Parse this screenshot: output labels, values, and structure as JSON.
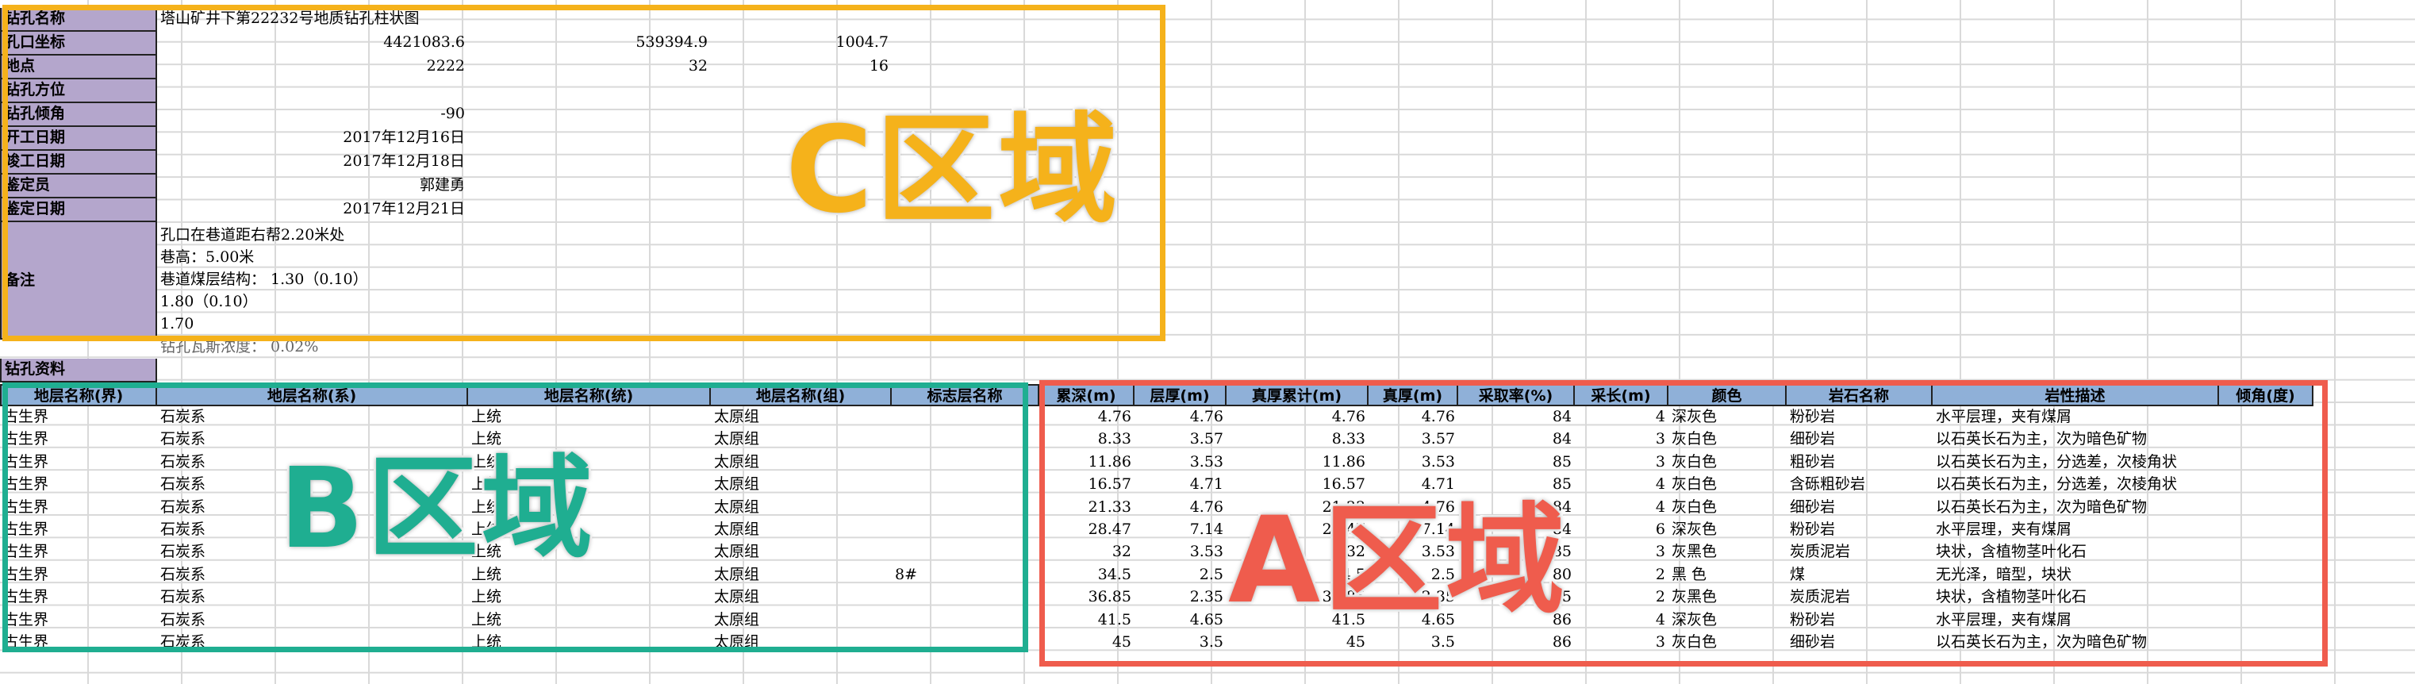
{
  "info": {
    "labels": [
      "钻孔名称",
      "孔口坐标",
      "地点",
      "钻孔方位",
      "钻孔倾角",
      "开工日期",
      "竣工日期",
      "鉴定员",
      "鉴定日期"
    ],
    "remark_label": "备注",
    "data_label": "钻孔资料",
    "name": "塔山矿井下第22232号地质钻孔柱状图",
    "coord_x": "4421083.6",
    "coord_y": "539394.9",
    "coord_z": "1004.7",
    "place_a": "2222",
    "place_b": "32",
    "place_c": "16",
    "azimuth": "",
    "dip": "-90",
    "start_date": "2017年12月16日",
    "end_date": "2017年12月18日",
    "inspector": "郭建勇",
    "inspect_date": "2017年12月21日",
    "remarks": [
      "孔口在巷道距右帮2.20米处",
      "巷高：5.00米",
      "巷道煤层结构： 1.30（0.10）",
      "1.80（0.10）",
      "1.70"
    ],
    "gas_text": "钻孔瓦斯浓度： 0.02%"
  },
  "table": {
    "headers": [
      "地层名称(界)",
      "地层名称(系)",
      "地层名称(统)",
      "地层名称(组)",
      "标志层名称",
      "累深(m)",
      "层厚(m)",
      "真厚累计(m)",
      "真厚(m)",
      "采取率(%)",
      "采长(m)",
      "颜色",
      "岩石名称",
      "岩性描述",
      "倾角(度)"
    ],
    "rows": [
      [
        "古生界",
        "石炭系",
        "上统",
        "太原组",
        "",
        "4.76",
        "4.76",
        "4.76",
        "4.76",
        "84",
        "4",
        "深灰色",
        "粉砂岩",
        "水平层理，夹有煤屑",
        ""
      ],
      [
        "古生界",
        "石炭系",
        "上统",
        "太原组",
        "",
        "8.33",
        "3.57",
        "8.33",
        "3.57",
        "84",
        "3",
        "灰白色",
        "细砂岩",
        "以石英长石为主，次为暗色矿物",
        ""
      ],
      [
        "古生界",
        "石炭系",
        "上统",
        "太原组",
        "",
        "11.86",
        "3.53",
        "11.86",
        "3.53",
        "85",
        "3",
        "灰白色",
        "粗砂岩",
        "以石英长石为主，分选差，次棱角状",
        ""
      ],
      [
        "古生界",
        "石炭系",
        "上统",
        "太原组",
        "",
        "16.57",
        "4.71",
        "16.57",
        "4.71",
        "85",
        "4",
        "灰白色",
        "含砾粗砂岩",
        "以石英长石为主，分选差，次棱角状",
        ""
      ],
      [
        "古生界",
        "石炭系",
        "上统",
        "太原组",
        "",
        "21.33",
        "4.76",
        "21.33",
        "4.76",
        "84",
        "4",
        "灰白色",
        "细砂岩",
        "以石英长石为主，次为暗色矿物",
        ""
      ],
      [
        "古生界",
        "石炭系",
        "上统",
        "太原组",
        "",
        "28.47",
        "7.14",
        "28.47",
        "7.14",
        "84",
        "6",
        "深灰色",
        "粉砂岩",
        "水平层理，夹有煤屑",
        ""
      ],
      [
        "古生界",
        "石炭系",
        "上统",
        "太原组",
        "",
        "32",
        "3.53",
        "32",
        "3.53",
        "85",
        "3",
        "灰黑色",
        "炭质泥岩",
        "块状，含植物茎叶化石",
        ""
      ],
      [
        "古生界",
        "石炭系",
        "上统",
        "太原组",
        "8#",
        "34.5",
        "2.5",
        "34.5",
        "2.5",
        "80",
        "2",
        "黑 色",
        "煤",
        "无光泽，暗型，块状",
        ""
      ],
      [
        "古生界",
        "石炭系",
        "上统",
        "太原组",
        "",
        "36.85",
        "2.35",
        "36.85",
        "2.35",
        "85",
        "2",
        "灰黑色",
        "炭质泥岩",
        "块状，含植物茎叶化石",
        ""
      ],
      [
        "古生界",
        "石炭系",
        "上统",
        "太原组",
        "",
        "41.5",
        "4.65",
        "41.5",
        "4.65",
        "86",
        "4",
        "深灰色",
        "粉砂岩",
        "水平层理，夹有煤屑",
        ""
      ],
      [
        "古生界",
        "石炭系",
        "上统",
        "太原组",
        "",
        "45",
        "3.5",
        "45",
        "3.5",
        "86",
        "3",
        "灰白色",
        "细砂岩",
        "以石英长石为主，次为暗色矿物",
        ""
      ]
    ]
  },
  "overlays": {
    "c_label": "C区域",
    "b_label": "B区域",
    "a_label": "A区域",
    "c_color": "#f5b21b",
    "b_color": "#1fae91",
    "a_color": "#ef5c4d"
  }
}
